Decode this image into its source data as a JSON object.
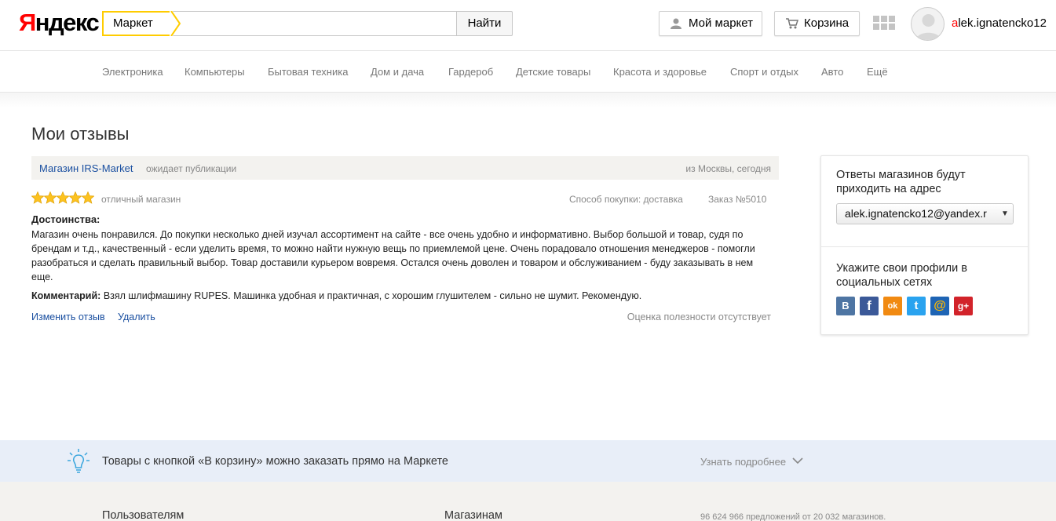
{
  "header": {
    "logo_first": "Я",
    "logo_rest": "ндекс",
    "service_tag": "Маркет",
    "search_value": "",
    "search_button": "Найти",
    "my_market": "Мой маркет",
    "cart": "Корзина",
    "username_first": "a",
    "username_rest": "lek.ignatencko12"
  },
  "catnav": {
    "items": [
      "Электроника",
      "Компьютеры",
      "Бытовая техника",
      "Дом и дача",
      "Гардероб",
      "Детские товары",
      "Красота и здоровье",
      "Спорт и отдых",
      "Авто",
      "Ещё"
    ]
  },
  "main": {
    "title": "Мои отзывы",
    "review": {
      "shop": "Магазин IRS-Market",
      "status": "ожидает публикации",
      "from": "из Москвы, сегодня",
      "stars": 5,
      "rating_text": "отличный магазин",
      "purchase": "Способ покупки: доставка",
      "order": "Заказ №5010",
      "pros_title": "Достоинства:",
      "pros_text": "Магазин очень понравился. До покупки несколько дней изучал ассортимент на сайте - все очень удобно и информативно. Выбор большой и товар, судя по брендам и т.д., качественный - если уделить время, то можно найти нужную вещь по приемлемой цене. Очень порадовало отношения менеджеров - помогли разобраться и сделать правильный выбор. Товар доставили курьером вовремя. Остался очень доволен и товаром и обслуживанием - буду заказывать в нем еще.",
      "comment_label": "Комментарий:",
      "comment_text": " Взял шлифмашину RUPES. Машинка удобная и практичная, с хорошим глушителем - сильно не шумит. Рекомендую.",
      "edit": "Изменить отзыв",
      "delete": "Удалить",
      "usefulness": "Оценка полезности отсутствует"
    }
  },
  "side": {
    "answers_text": "Ответы магазинов будут приходить на адрес",
    "email": "alek.ignatencko12@yandex.r",
    "social_text": "Укажите свои профили в социальных сетях",
    "social": [
      {
        "name": "vk-icon",
        "glyph": "В",
        "color": "#4e75a3"
      },
      {
        "name": "facebook-icon",
        "glyph": "f",
        "color": "#3b5998"
      },
      {
        "name": "odnoklassniki-icon",
        "glyph": "ok",
        "color": "#f18a12"
      },
      {
        "name": "twitter-icon",
        "glyph": "t",
        "color": "#2aa3ef"
      },
      {
        "name": "mailru-icon",
        "glyph": "@",
        "color": "#1e64b4"
      },
      {
        "name": "google-plus-icon",
        "glyph": "g+",
        "color": "#d2232a"
      }
    ]
  },
  "banner": {
    "text": "Товары с кнопкой «В корзину» можно заказать прямо на Маркете",
    "learn_more": "Узнать подробнее"
  },
  "footer": {
    "users": "Пользователям",
    "shops": "Магазинам",
    "stats": "96 624 966 предложений от 20 032 магазинов."
  }
}
